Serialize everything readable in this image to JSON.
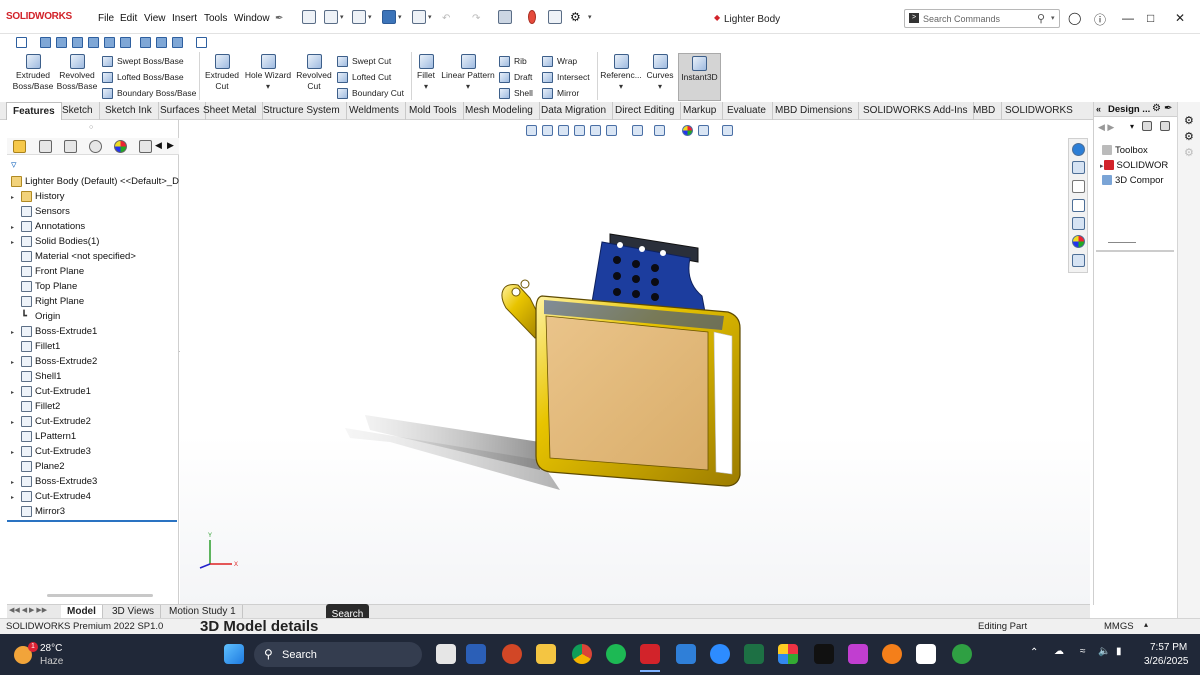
{
  "app": {
    "name": "SOLIDWORKS",
    "document_title": "Lighter Body"
  },
  "menu": [
    "File",
    "Edit",
    "View",
    "Insert",
    "Tools",
    "Window"
  ],
  "search": {
    "placeholder": "Search Commands"
  },
  "features_ribbon": {
    "extruded_boss": "Extruded Boss/Base",
    "revolved_boss": "Revolved Boss/Base",
    "swept_boss": "Swept Boss/Base",
    "lofted_boss": "Lofted Boss/Base",
    "boundary_boss": "Boundary Boss/Base",
    "extruded_cut": "Extruded Cut",
    "hole_wizard": "Hole Wizard",
    "revolved_cut": "Revolved Cut",
    "swept_cut": "Swept Cut",
    "lofted_cut": "Lofted Cut",
    "boundary_cut": "Boundary Cut",
    "fillet": "Fillet",
    "linear_pattern": "Linear Pattern",
    "rib": "Rib",
    "draft": "Draft",
    "shell": "Shell",
    "wrap": "Wrap",
    "intersect": "Intersect",
    "mirror": "Mirror",
    "reference": "Referenc...",
    "curves": "Curves",
    "instant3d": "Instant3D"
  },
  "tabs": [
    "Features",
    "Sketch",
    "Sketch Ink",
    "Surfaces",
    "Sheet Metal",
    "Structure System",
    "Weldments",
    "Mold Tools",
    "Mesh Modeling",
    "Data Migration",
    "Direct Editing",
    "Markup",
    "Evaluate",
    "MBD Dimensions",
    "SOLIDWORKS Add-Ins",
    "MBD",
    "SOLIDWORKS CAM"
  ],
  "feature_tree": {
    "root": "Lighter Body (Default) <<Default>_D",
    "items": [
      {
        "label": "History",
        "expandable": true,
        "icon": "folder-icon"
      },
      {
        "label": "Sensors",
        "expandable": false,
        "icon": "sensor-icon"
      },
      {
        "label": "Annotations",
        "expandable": true,
        "icon": "annotation-icon"
      },
      {
        "label": "Solid Bodies(1)",
        "expandable": true,
        "icon": "solid-bodies-icon"
      },
      {
        "label": "Material <not specified>",
        "expandable": false,
        "icon": "material-icon"
      },
      {
        "label": "Front Plane",
        "expandable": false,
        "icon": "plane-icon"
      },
      {
        "label": "Top Plane",
        "expandable": false,
        "icon": "plane-icon"
      },
      {
        "label": "Right Plane",
        "expandable": false,
        "icon": "plane-icon"
      },
      {
        "label": "Origin",
        "expandable": false,
        "icon": "origin-icon"
      },
      {
        "label": "Boss-Extrude1",
        "expandable": true,
        "icon": "boss-extrude-icon"
      },
      {
        "label": "Fillet1",
        "expandable": false,
        "icon": "fillet-icon"
      },
      {
        "label": "Boss-Extrude2",
        "expandable": true,
        "icon": "boss-extrude-icon"
      },
      {
        "label": "Shell1",
        "expandable": false,
        "icon": "shell-icon"
      },
      {
        "label": "Cut-Extrude1",
        "expandable": true,
        "icon": "cut-extrude-icon"
      },
      {
        "label": "Fillet2",
        "expandable": false,
        "icon": "fillet-icon"
      },
      {
        "label": "Cut-Extrude2",
        "expandable": true,
        "icon": "cut-extrude-icon"
      },
      {
        "label": "LPattern1",
        "expandable": false,
        "icon": "linear-pattern-icon"
      },
      {
        "label": "Cut-Extrude3",
        "expandable": true,
        "icon": "cut-extrude-icon"
      },
      {
        "label": "Plane2",
        "expandable": false,
        "icon": "plane-icon"
      },
      {
        "label": "Boss-Extrude3",
        "expandable": true,
        "icon": "boss-extrude-icon"
      },
      {
        "label": "Cut-Extrude4",
        "expandable": true,
        "icon": "cut-extrude-icon"
      },
      {
        "label": "Mirror3",
        "expandable": false,
        "icon": "mirror-icon"
      }
    ]
  },
  "design_library": {
    "title": "Design ...",
    "items": [
      "Toolbox",
      "SOLIDWOR",
      "3D Compor"
    ]
  },
  "bottom_tabs": [
    "Model",
    "3D Views",
    "Motion Study 1"
  ],
  "tooltip": "Search",
  "status": {
    "left": "SOLIDWORKS Premium 2022 SP1.0",
    "mode": "Editing Part",
    "units": "MMGS",
    "overlay_text": "3D Model details"
  },
  "taskbar": {
    "weather_temp": "28°C",
    "weather_desc": "Haze",
    "weather_badge": "1",
    "search_label": "Search",
    "time": "7:57 PM",
    "date": "3/26/2025"
  },
  "colors": {
    "accent": "#2a73c2",
    "brand_red": "#d2232a",
    "model_gold": "#d8b400",
    "model_tan": "#e0b776",
    "model_blue": "#1c3d9e"
  }
}
